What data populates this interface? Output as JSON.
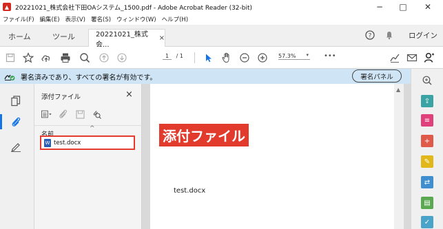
{
  "window": {
    "title": "20221021_株式会社下田OAシステム_1500.pdf - Adobe Acrobat Reader (32-bit)",
    "app_icon": "acrobat-icon",
    "controls": [
      "−",
      "□",
      "✕"
    ]
  },
  "menu": {
    "items": [
      "ファイル(F)",
      "編集(E)",
      "表示(V)",
      "署名(S)",
      "ウィンドウ(W)",
      "ヘルプ(H)"
    ]
  },
  "tabs": {
    "home": "ホーム",
    "tools": "ツール",
    "document": "20221021_株式会...",
    "close": "×",
    "login": "ログイン"
  },
  "toolbar": {
    "page_current": "1",
    "page_total": "/ 1",
    "zoom": "57.3%",
    "more": "•••"
  },
  "signature_bar": {
    "message": "署名済みであり、すべての署名が有効です。",
    "button": "署名パネル"
  },
  "attachments": {
    "title": "添付ファイル",
    "close": "×",
    "column_name": "名前",
    "sort_indicator": "^",
    "files": [
      "test.docx"
    ]
  },
  "document": {
    "body_text": "test.docx"
  },
  "callout": {
    "label": "添付ファイル",
    "color": "#e23a2c"
  },
  "colors": {
    "accent": "#1473e6",
    "signature_bar": "#cfe4f5"
  }
}
